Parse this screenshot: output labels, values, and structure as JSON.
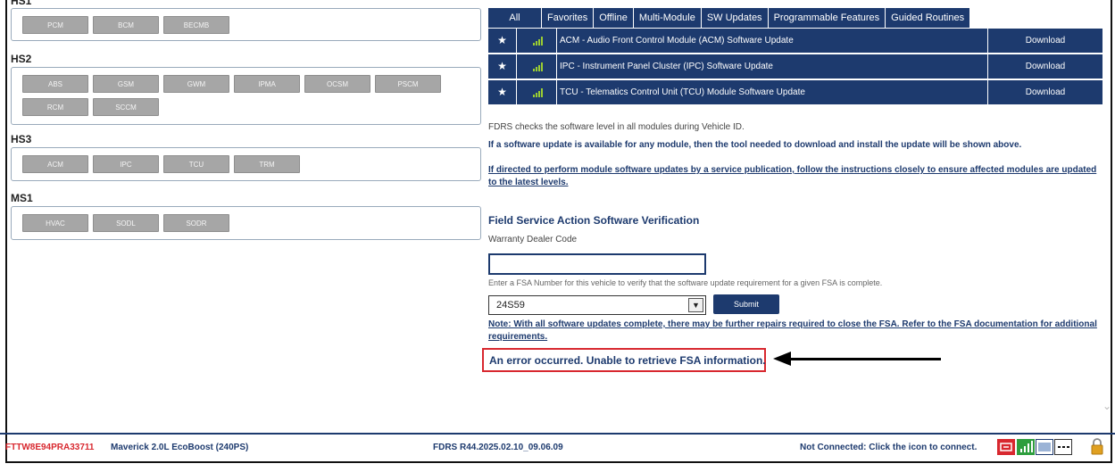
{
  "networks": [
    {
      "name": "HS1",
      "modules": [
        "PCM",
        "BCM",
        "BECMB"
      ]
    },
    {
      "name": "HS2",
      "modules": [
        "ABS",
        "GSM",
        "GWM",
        "IPMA",
        "OCSM",
        "PSCM",
        "RCM",
        "SCCM"
      ]
    },
    {
      "name": "HS3",
      "modules": [
        "ACM",
        "IPC",
        "TCU",
        "TRM"
      ]
    },
    {
      "name": "MS1",
      "modules": [
        "HVAC",
        "SODL",
        "SODR"
      ]
    }
  ],
  "tabs": [
    "All",
    "Favorites",
    "Offline",
    "Multi-Module",
    "SW Updates",
    "Programmable Features",
    "Guided Routines"
  ],
  "updates": [
    {
      "description": "ACM - Audio Front Control Module (ACM) Software Update",
      "action": "Download"
    },
    {
      "description": "IPC - Instrument Panel Cluster (IPC) Software Update",
      "action": "Download"
    },
    {
      "description": "TCU - Telematics Control Unit (TCU) Module Software Update",
      "action": "Download"
    }
  ],
  "info": {
    "line1": "FDRS checks the software level in all modules during Vehicle ID.",
    "line2": "If a software update is available for any module, then the tool needed to download and install the update will be shown above.",
    "line3": "If directed to perform module software updates by a service publication, follow the instructions closely to ensure affected modules are updated to the latest levels."
  },
  "fsa": {
    "title": "Field Service Action Software Verification",
    "dealer_label": "Warranty Dealer Code",
    "dealer_value": "",
    "fsa_label": "Enter a FSA Number for this vehicle to verify that the software update requirement for a given FSA is complete.",
    "fsa_value": "24S59",
    "submit": "Submit",
    "note": "Note: With all software updates complete, there may be further repairs required to close the FSA. Refer to the FSA documentation for additional requirements.",
    "error": "An error occurred. Unable to retrieve FSA information."
  },
  "footer": {
    "vin": "FTTW8E94PRA33711",
    "vehicle": "Maverick 2.0L EcoBoost (240PS)",
    "version": "FDRS R44.2025.02.10_09.06.09",
    "connection": "Not Connected: Click the icon to connect."
  },
  "colors": {
    "navy": "#1d3a6e",
    "module_button": "#a6a6a6",
    "error_red": "#d8282f",
    "signal_green": "#9acd32"
  },
  "icons": {
    "favorite": "star-icon",
    "signal": "signal-bars-icon",
    "connect": "connector-icon",
    "lock": "lock-icon"
  }
}
